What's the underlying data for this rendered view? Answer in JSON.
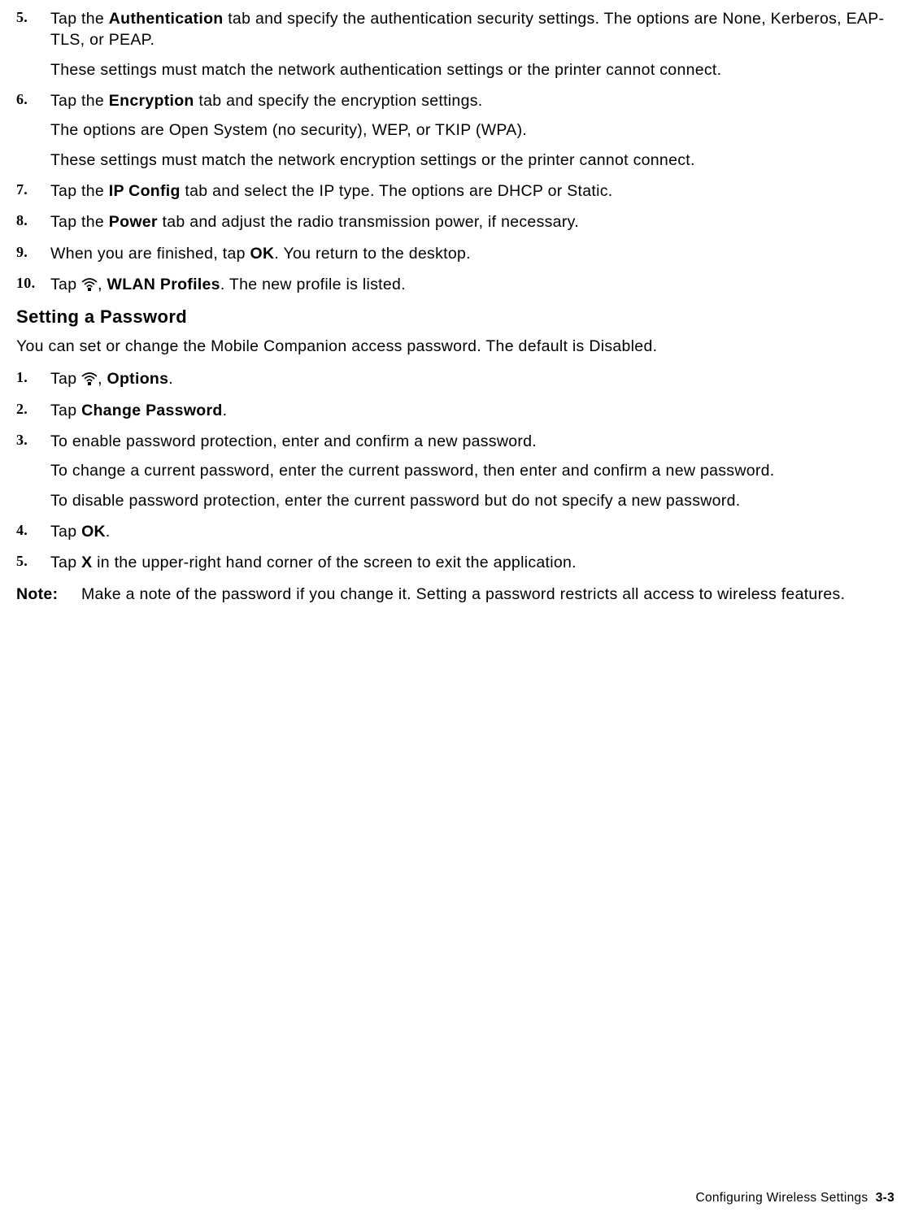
{
  "listA": [
    {
      "num": "5.",
      "paras": [
        [
          {
            "t": "Tap the "
          },
          {
            "t": "Authentication",
            "b": true
          },
          {
            "t": " tab and specify the authentication security settings. The options are None, Kerberos, EAP-TLS, or PEAP."
          }
        ],
        [
          {
            "t": "These settings must match the network authentication settings or the printer cannot connect."
          }
        ]
      ]
    },
    {
      "num": "6.",
      "paras": [
        [
          {
            "t": "Tap the "
          },
          {
            "t": "Encryption",
            "b": true
          },
          {
            "t": " tab and specify the encryption settings."
          }
        ],
        [
          {
            "t": "The options are Open System (no security), WEP, or TKIP (WPA)."
          }
        ],
        [
          {
            "t": "These settings must match the network encryption settings or the printer cannot connect."
          }
        ]
      ]
    },
    {
      "num": "7.",
      "paras": [
        [
          {
            "t": "Tap the "
          },
          {
            "t": "IP Config",
            "b": true
          },
          {
            "t": " tab and select the IP type. The options are DHCP or Static."
          }
        ]
      ]
    },
    {
      "num": "8.",
      "paras": [
        [
          {
            "t": "Tap the "
          },
          {
            "t": "Power",
            "b": true
          },
          {
            "t": " tab and adjust the radio transmission power, if necessary."
          }
        ]
      ]
    },
    {
      "num": "9.",
      "paras": [
        [
          {
            "t": "When you are finished, tap "
          },
          {
            "t": "OK",
            "b": true
          },
          {
            "t": ". You return to the desktop."
          }
        ]
      ]
    },
    {
      "num": "10.",
      "paras": [
        [
          {
            "t": "Tap "
          },
          {
            "icon": "signal-icon"
          },
          {
            "t": ", "
          },
          {
            "t": "WLAN Profiles",
            "b": true
          },
          {
            "t": ". The new profile is listed."
          }
        ]
      ]
    }
  ],
  "heading": "Setting a Password",
  "intro": "You can set or change the Mobile Companion access password.  The default is Disabled.",
  "listB": [
    {
      "num": "1.",
      "paras": [
        [
          {
            "t": "Tap "
          },
          {
            "icon": "signal-icon"
          },
          {
            "t": ", "
          },
          {
            "t": "Options",
            "b": true
          },
          {
            "t": "."
          }
        ]
      ]
    },
    {
      "num": "2.",
      "paras": [
        [
          {
            "t": "Tap "
          },
          {
            "t": "Change Password",
            "b": true
          },
          {
            "t": "."
          }
        ]
      ]
    },
    {
      "num": "3.",
      "paras": [
        [
          {
            "t": "To enable password protection, enter and confirm a new password."
          }
        ],
        [
          {
            "t": "To change a current password, enter the current password, then enter and confirm a new password."
          }
        ],
        [
          {
            "t": "To disable password protection, enter the current password but do not specify a new password."
          }
        ]
      ]
    },
    {
      "num": "4.",
      "paras": [
        [
          {
            "t": "Tap "
          },
          {
            "t": "OK",
            "b": true
          },
          {
            "t": "."
          }
        ]
      ]
    },
    {
      "num": "5.",
      "paras": [
        [
          {
            "t": "Tap "
          },
          {
            "t": "X",
            "b": true
          },
          {
            "t": " in the upper-right hand corner of the screen to exit the application."
          }
        ]
      ]
    }
  ],
  "note": {
    "label": "Note:",
    "body": "Make a note of the password if you change it. Setting a password restricts all access to wireless features."
  },
  "footer": {
    "title": "Configuring Wireless Settings",
    "page": "3-3"
  },
  "icons": {
    "signal-icon": "wireless signal strength icon"
  }
}
